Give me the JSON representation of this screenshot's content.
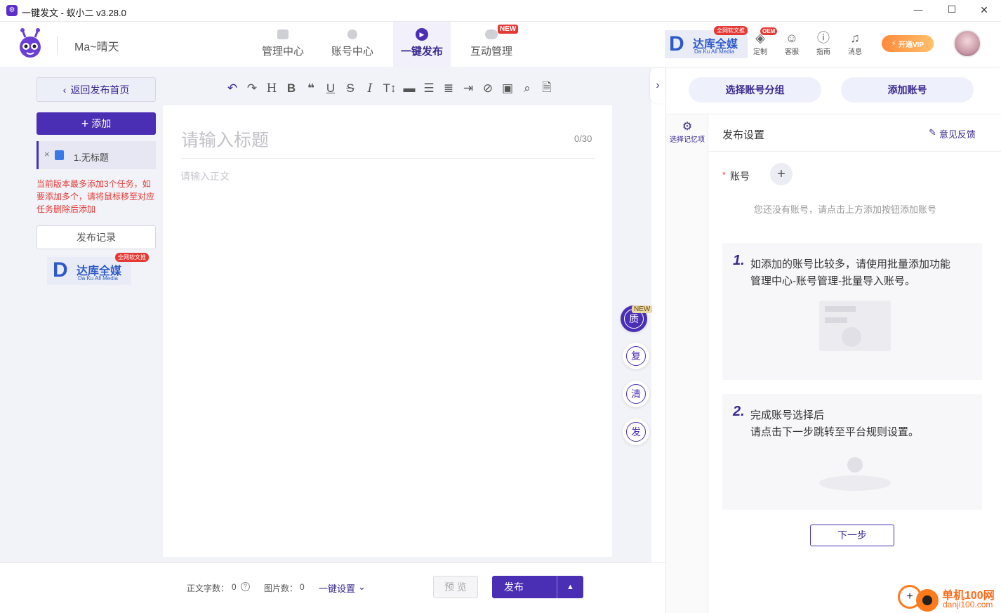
{
  "window": {
    "title": "一键发文 - 蚁小二 v3.28.0",
    "minimize": "—",
    "maximize": "☐",
    "close": "✕"
  },
  "header": {
    "user": "Ma~晴天",
    "tabs": [
      {
        "label": "管理中心"
      },
      {
        "label": "账号中心"
      },
      {
        "label": "一键发布"
      },
      {
        "label": "互动管理",
        "badge": "NEW"
      }
    ],
    "dk_banner": {
      "name": "达库全媒",
      "sub": "Da Ku All Media",
      "tag": "全网软文推"
    },
    "icons": [
      {
        "label": "定制",
        "badge": "OEM"
      },
      {
        "label": "客服"
      },
      {
        "label": "指南"
      },
      {
        "label": "消息"
      }
    ],
    "vip": "开通VIP"
  },
  "left": {
    "back": "返回发布首页",
    "add": "添加",
    "task": "1.无标题",
    "task_close": "×",
    "warning": "当前版本最多添加3个任务，如要添加多个，请将鼠标移至对应任务删除后添加",
    "history": "发布记录",
    "dk_banner": {
      "name": "达库全媒",
      "sub": "Da Ku All Media",
      "tag": "全网软文推"
    }
  },
  "editor": {
    "title_placeholder": "请输入标题",
    "counter": "0/30",
    "body_placeholder": "请输入正文",
    "toolbar": [
      "undo-icon",
      "redo-icon",
      "heading-icon",
      "bold-icon",
      "quote-icon",
      "underline-icon",
      "strikethrough-icon",
      "italic-icon",
      "text-size-icon",
      "divider-icon",
      "list-icon",
      "align-icon",
      "indent-icon",
      "clear-format-icon",
      "image-icon",
      "search-icon",
      "document-icon"
    ]
  },
  "side_tools": {
    "items": [
      "质",
      "复",
      "清",
      "发"
    ],
    "badge": "NEW"
  },
  "bottom": {
    "word_label": "正文字数：",
    "word_count": "0",
    "image_label": "图片数：",
    "image_count": "0",
    "settings": "一键设置",
    "preview": "预 览",
    "publish": "发布"
  },
  "right": {
    "select_group": "选择账号分组",
    "add_account": "添加账号",
    "memory": "选择记忆项",
    "section_title": "发布设置",
    "feedback": "意见反馈",
    "account_label": "账号",
    "required_mark": "*",
    "empty": "您还没有账号，请点击上方添加按钮添加账号",
    "tips": [
      {
        "num": "1.",
        "line1": "如添加的账号比较多，请使用批量添加功能",
        "line2": "管理中心-账号管理-批量导入账号。"
      },
      {
        "num": "2.",
        "line1": "完成账号选择后",
        "line2": "请点击下一步跳转至平台规则设置。"
      }
    ],
    "next": "下一步"
  },
  "watermark": {
    "name": "单机100网",
    "url": "danji100.com"
  },
  "colors": {
    "primary": "#4a2fb4",
    "accent_red": "#e53935",
    "light_bg": "#f2f3f8"
  }
}
